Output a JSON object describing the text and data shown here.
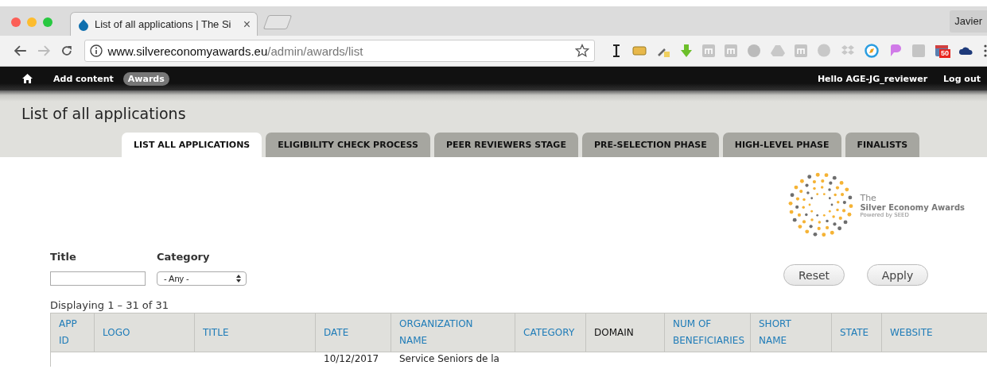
{
  "browser": {
    "tab": {
      "title": "List of all applications | The Si",
      "close": "×"
    },
    "profile": "Javier",
    "url": {
      "host": "www.silvereconomyawards.eu",
      "path": "/admin/awards/list"
    },
    "extension_badge": "50"
  },
  "admin_bar": {
    "items": [
      {
        "label": "Add content",
        "selected": false
      },
      {
        "label": "Awards",
        "selected": true
      }
    ],
    "greeting": "Hello AGE-JG_reviewer",
    "logout": "Log out"
  },
  "page_title": "List of all applications",
  "tabs": [
    {
      "label": "LIST ALL APPLICATIONS",
      "selected": true
    },
    {
      "label": "ELIGIBILITY CHECK PROCESS",
      "selected": false
    },
    {
      "label": "PEER REVIEWERS STAGE",
      "selected": false
    },
    {
      "label": "PRE-SELECTION PHASE",
      "selected": false
    },
    {
      "label": "HIGH-LEVEL PHASE",
      "selected": false
    },
    {
      "label": "FINALISTS",
      "selected": false
    }
  ],
  "logo": {
    "line_1": "The",
    "line_2": "Silver Economy Awards",
    "line_3": "Powered by SEED"
  },
  "filters": {
    "title": {
      "label": "Title"
    },
    "category": {
      "label": "Category",
      "value": "- Any -"
    },
    "buttons": [
      "Reset",
      "Apply"
    ]
  },
  "result_summary": "Displaying 1 – 31 of 31",
  "table": {
    "columns": [
      {
        "label": "APP ID",
        "sortable": true
      },
      {
        "label": "LOGO",
        "sortable": true
      },
      {
        "label": "TITLE",
        "sortable": true
      },
      {
        "label": "DATE",
        "sortable": true
      },
      {
        "label": "ORGANIZATION NAME",
        "sortable": true
      },
      {
        "label": "CATEGORY",
        "sortable": true
      },
      {
        "label": "DOMAIN",
        "sortable": false
      },
      {
        "label": "NUM OF BENEFICIARIES",
        "sortable": true
      },
      {
        "label": "SHORT NAME",
        "sortable": true
      },
      {
        "label": "STATE",
        "sortable": true
      },
      {
        "label": "WEBSITE",
        "sortable": true
      }
    ],
    "rows": [
      {
        "date": "10/12/2017",
        "organization_name": "Service Seniors de la"
      }
    ]
  }
}
